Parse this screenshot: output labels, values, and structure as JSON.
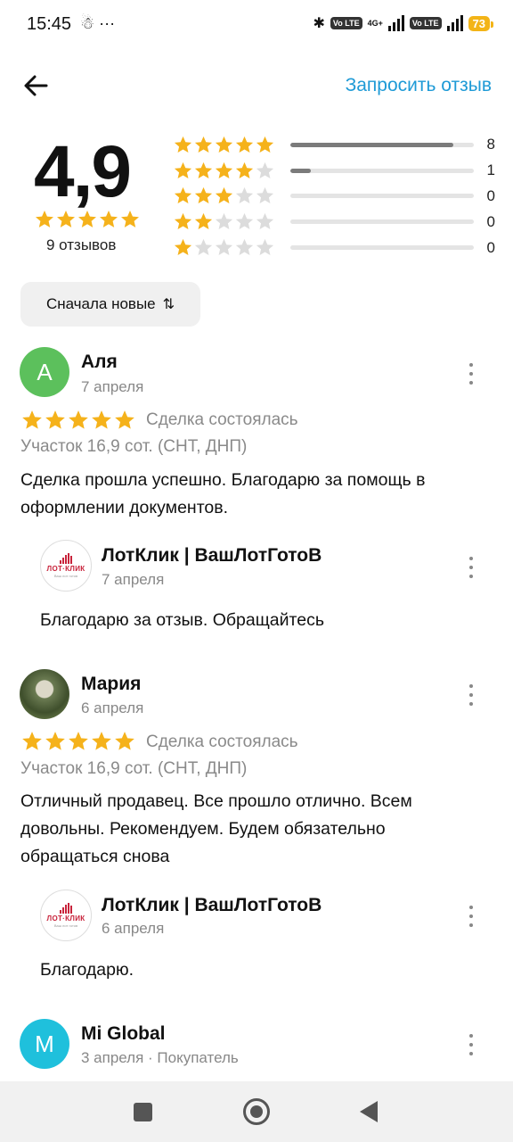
{
  "status_bar": {
    "time": "15:45",
    "left_icons": "☃ ···",
    "chip1": "Vo LTE",
    "net": "4G+",
    "chip2": "Vo LTE",
    "battery": "73"
  },
  "header": {
    "back_icon": "arrow-left-icon",
    "request_review_label": "Запросить отзыв"
  },
  "summary": {
    "rating": "4,9",
    "reviews_count": "9 отзывов",
    "distribution": [
      {
        "stars": 5,
        "count": "8",
        "fraction": 0.89
      },
      {
        "stars": 4,
        "count": "1",
        "fraction": 0.11
      },
      {
        "stars": 3,
        "count": "0",
        "fraction": 0
      },
      {
        "stars": 2,
        "count": "0",
        "fraction": 0
      },
      {
        "stars": 1,
        "count": "0",
        "fraction": 0
      }
    ]
  },
  "sort": {
    "label": "Сначала новые",
    "icon": "⇅"
  },
  "reviews": [
    {
      "avatar_letter": "А",
      "name": "Аля",
      "date": "7 апреля",
      "stars": 5,
      "deal_status": "Сделка состоялась",
      "lot": "Участок 16,9 сот. (СНТ, ДНП)",
      "text": "Сделка прошла успешно. Благодарю за помощь в оформлении документов.",
      "reply": {
        "name": "ЛотКлик | ВашЛотГотоВ",
        "date": "7 апреля",
        "text": "Благодарю за отзыв. Обращайтесь"
      }
    },
    {
      "avatar_letter": "",
      "name": "Мария",
      "date": "6 апреля",
      "stars": 5,
      "deal_status": "Сделка состоялась",
      "lot": "Участок 16,9 сот. (СНТ, ДНП)",
      "text": "Отличный продавец. Все прошло отлично. Всем довольны. Рекомендуем. Будем обязательно обращаться снова",
      "reply": {
        "name": "ЛотКлик | ВашЛотГотоВ",
        "date": "6 апреля",
        "text": "Благодарю."
      }
    },
    {
      "avatar_letter": "M",
      "name": "Mi Global",
      "date": "3 апреля · Покупатель"
    }
  ],
  "logo": {
    "text": "ЛОТ·КЛИК",
    "subtext": "Ваш лот готов"
  },
  "colors": {
    "star": "#f5b21b",
    "star_empty": "#dcdcdc",
    "link": "#1e9ad6",
    "bar_fill": "#7b7b7b"
  }
}
